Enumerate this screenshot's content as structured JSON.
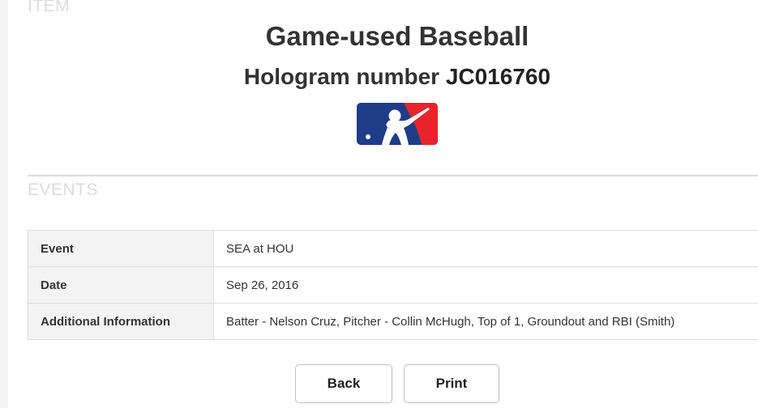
{
  "sections": {
    "item_label": "ITEM",
    "events_label": "EVENTS"
  },
  "item": {
    "title": "Game-used Baseball",
    "hologram_prefix": "Hologram number",
    "hologram_code": "JC016760",
    "logo_icon": "mlb-logo-icon"
  },
  "events_table": {
    "rows": [
      {
        "label": "Event",
        "value": "SEA at HOU"
      },
      {
        "label": "Date",
        "value": "Sep 26, 2016"
      },
      {
        "label": "Additional Information",
        "value": "Batter - Nelson Cruz, Pitcher - Collin McHugh, Top of 1, Groundout and RBI (Smith)"
      }
    ]
  },
  "buttons": {
    "back_label": "Back",
    "print_label": "Print"
  },
  "colors": {
    "logo_blue": "#1f3c88",
    "logo_red": "#e8242b",
    "label_gray": "#dcdcdc",
    "table_key_bg": "#f3f3f3"
  }
}
